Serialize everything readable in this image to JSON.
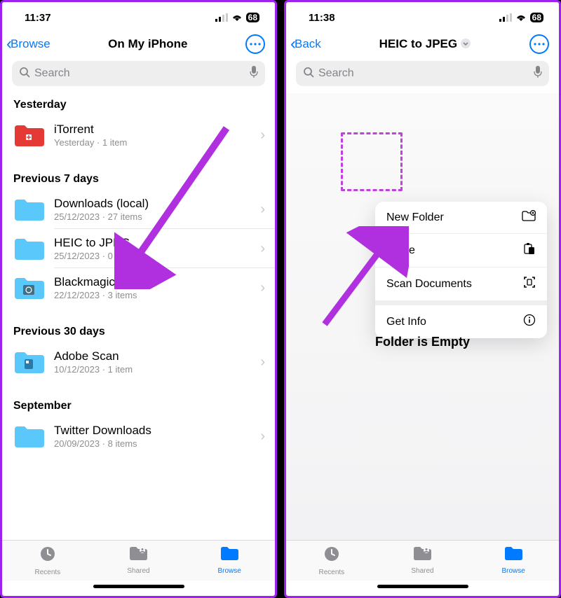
{
  "left": {
    "status": {
      "time": "11:37",
      "battery": "68"
    },
    "nav": {
      "back": "Browse",
      "title": "On My iPhone"
    },
    "search": {
      "placeholder": "Search"
    },
    "sections": [
      {
        "header": "Yesterday",
        "items": [
          {
            "name": "iTorrent",
            "sub": "Yesterday · 1 item",
            "icon": "red"
          }
        ]
      },
      {
        "header": "Previous 7 days",
        "items": [
          {
            "name": "Downloads (local)",
            "sub": "25/12/2023 · 27 items",
            "icon": "blue"
          },
          {
            "name": "HEIC to JPEG",
            "sub": "25/12/2023 · 0 items",
            "icon": "blue"
          },
          {
            "name": "Blackmagic Cam",
            "sub": "22/12/2023 · 3 items",
            "icon": "cam"
          }
        ]
      },
      {
        "header": "Previous 30 days",
        "items": [
          {
            "name": "Adobe Scan",
            "sub": "10/12/2023 · 1 item",
            "icon": "adobe"
          }
        ]
      },
      {
        "header": "September",
        "items": [
          {
            "name": "Twitter Downloads",
            "sub": "20/09/2023 · 8 items",
            "icon": "blue"
          }
        ]
      }
    ]
  },
  "right": {
    "status": {
      "time": "11:38",
      "battery": "68"
    },
    "nav": {
      "back": "Back",
      "title": "HEIC to JPEG"
    },
    "search": {
      "placeholder": "Search"
    },
    "empty": "Folder is Empty",
    "menu": [
      {
        "label": "New Folder",
        "icon": "newfolder"
      },
      {
        "label": "Paste",
        "icon": "paste"
      },
      {
        "label": "Scan Documents",
        "icon": "scan"
      },
      {
        "label": "Get Info",
        "icon": "info"
      }
    ]
  },
  "tabs": {
    "recents": "Recents",
    "shared": "Shared",
    "browse": "Browse"
  }
}
